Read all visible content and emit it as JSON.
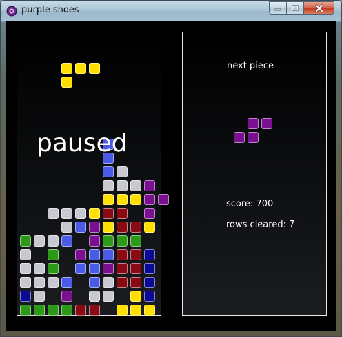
{
  "window": {
    "title": "purple shoes",
    "controls": [
      "minimize",
      "maximize",
      "close"
    ]
  },
  "game": {
    "paused_label": "paused",
    "colors": {
      "Y": "#ffe000",
      "B": "#4a5be8",
      "S": "#c8c8d0",
      "P": "#7a1090",
      "R": "#8a0a14",
      "G": "#2c9a18",
      "N": "#0a0a94"
    },
    "falling_piece": {
      "color": "Y",
      "cells": [
        [
          0,
          0
        ],
        [
          1,
          0
        ],
        [
          2,
          0
        ],
        [
          0,
          1
        ]
      ]
    },
    "board_rows": [
      "..........",
      "..........",
      "..........",
      "..........",
      "..........",
      "..........",
      "..........",
      "..........",
      "..........",
      "......B...",
      "......B...",
      "......BS..",
      "......SSSP",
      "......YYYPP",
      "..SSSYRR.P",
      "...SBPYRRY",
      "GSSB.PGGG.",
      "S.G.PBBRRN",
      "SSG.BBPRRN",
      "SSSB.BSRRN",
      "NS.P.SS.YN",
      "GGGGRR.YYY"
    ]
  },
  "info": {
    "next_label": "next piece",
    "next_piece": {
      "color": "P",
      "cells": [
        [
          1,
          0
        ],
        [
          2,
          0
        ],
        [
          0,
          1
        ],
        [
          1,
          1
        ]
      ]
    },
    "score_label": "score: 700",
    "rows_label": "rows cleared: 7"
  }
}
